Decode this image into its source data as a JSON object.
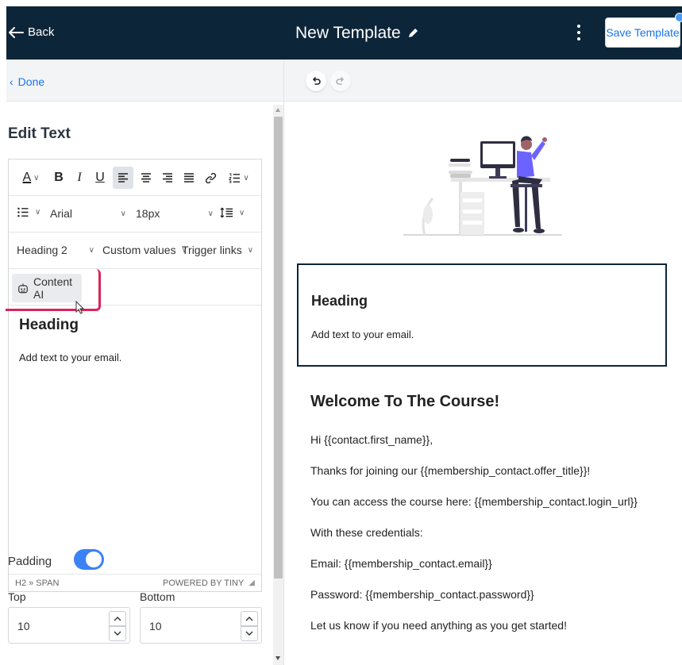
{
  "header": {
    "back_label": "Back",
    "title": "New Template",
    "save_label": "Save Template"
  },
  "left": {
    "done_label": "Done",
    "section_title": "Edit Text",
    "toolbar": {
      "font_family": "Arial",
      "font_size": "18px",
      "block_format": "Heading 2",
      "custom_values": "Custom values",
      "trigger_links": "Trigger links",
      "content_ai": "Content AI"
    },
    "editor": {
      "heading": "Heading",
      "text": "Add text to your email.",
      "path": "H2 » SPAN",
      "powered_by": "POWERED BY TINY"
    },
    "padding": {
      "label": "Padding",
      "enabled": true,
      "top_label": "Top",
      "bottom_label": "Bottom",
      "top_value": "10",
      "bottom_value": "10"
    }
  },
  "preview": {
    "selected_block": {
      "heading": "Heading",
      "text": "Add text to your email."
    },
    "content": {
      "heading": "Welcome To The Course!",
      "lines": [
        "Hi {{contact.first_name}},",
        "Thanks for joining our {{membership_contact.offer_title}}!",
        "You can access the course here: {{membership_contact.login_url}}",
        "With these credentials:",
        "Email: {{membership_contact.email}}",
        "Password: {{membership_contact.password}}",
        "Let us know if you need anything as you get started!"
      ]
    }
  },
  "colors": {
    "header_bg": "#0d2538",
    "accent": "#1a73e8",
    "highlight": "#d9235b",
    "illustration_purple": "#6c63ff"
  }
}
